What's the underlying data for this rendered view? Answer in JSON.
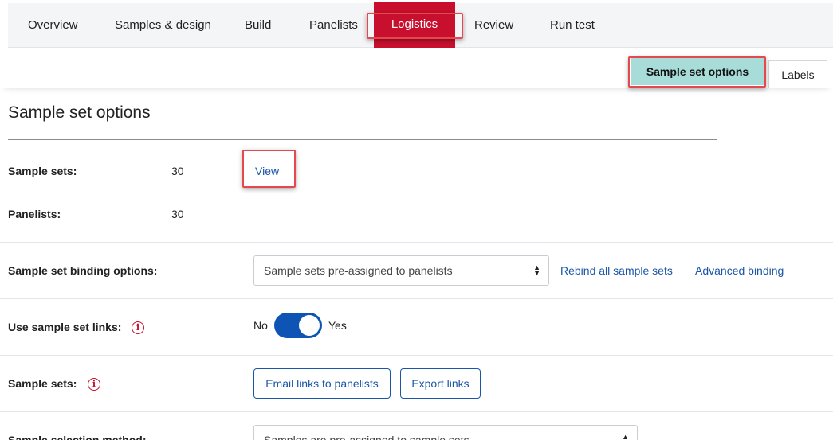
{
  "nav": {
    "items": [
      {
        "label": "Overview"
      },
      {
        "label": "Samples & design"
      },
      {
        "label": "Build"
      },
      {
        "label": "Panelists"
      },
      {
        "label": "Logistics"
      },
      {
        "label": "Review"
      },
      {
        "label": "Run test"
      }
    ],
    "active": "Logistics",
    "active_color": "#c8102e"
  },
  "subtabs": {
    "sample_set_options": "Sample set options",
    "labels": "Labels",
    "active_color": "#a8dcd9"
  },
  "section": {
    "title": "Sample set options"
  },
  "summary": {
    "sample_sets_label": "Sample sets:",
    "sample_sets_value": "30",
    "view_link": "View",
    "panelists_label": "Panelists:",
    "panelists_value": "30"
  },
  "binding": {
    "label": "Sample set binding options:",
    "selected": "Sample sets pre-assigned to panelists",
    "rebind_link": "Rebind all sample sets",
    "advanced_link": "Advanced binding"
  },
  "links_toggle": {
    "label": "Use sample set links:",
    "off_label": "No",
    "on_label": "Yes",
    "state": "on",
    "color": "#0e54b5"
  },
  "sample_sets_row": {
    "label": "Sample sets:",
    "email_button": "Email links to panelists",
    "export_button": "Export links"
  },
  "selection": {
    "label": "Sample selection method:",
    "selected": "Samples are pre-assigned to sample sets"
  },
  "icons": {
    "info": "i",
    "select_up": "▲",
    "select_down": "▼"
  }
}
